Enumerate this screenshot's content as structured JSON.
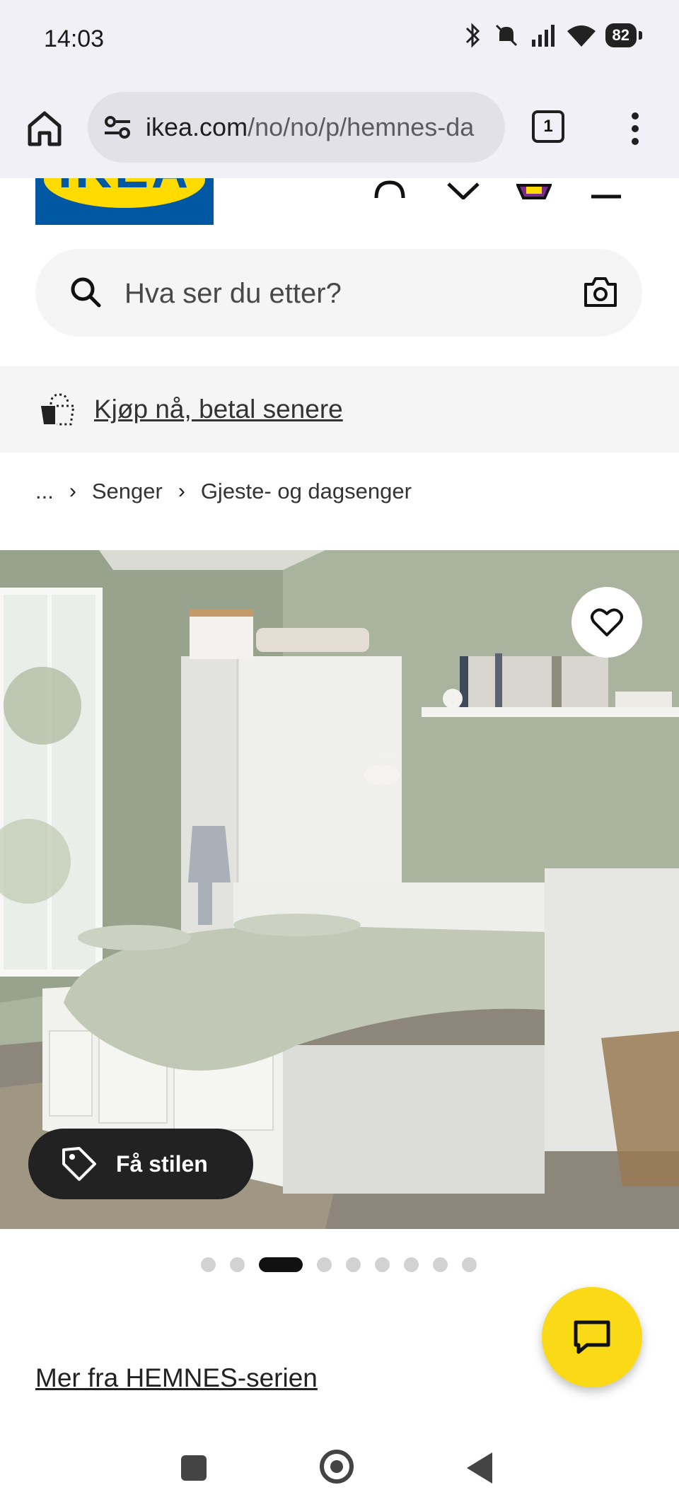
{
  "status_bar": {
    "time": "14:03",
    "battery": "82"
  },
  "browser": {
    "url_domain": "ikea.com",
    "url_path": "/no/no/p/hemnes-da",
    "tab_count": "1"
  },
  "header": {
    "logo_text": "IKEA"
  },
  "search": {
    "placeholder": "Hva ser du etter?"
  },
  "promo": {
    "link_text": "Kjøp nå, betal senere"
  },
  "breadcrumb": {
    "items": [
      "...",
      "Senger",
      "Gjeste- og dagsenger"
    ],
    "separator": "›"
  },
  "hero": {
    "style_button_label": "Få stilen"
  },
  "carousel": {
    "count": 9,
    "active_index": 2
  },
  "series_link": "Mer fra HEMNES-serien",
  "colors": {
    "ikea_blue": "#0058a3",
    "ikea_yellow": "#ffdb00",
    "chat_yellow": "#fada16"
  }
}
